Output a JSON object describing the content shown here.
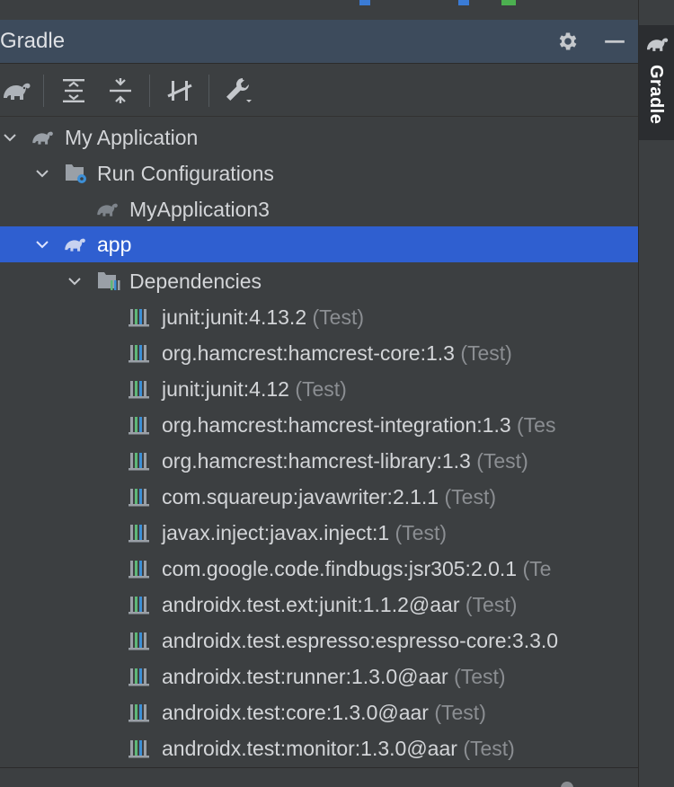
{
  "panel": {
    "title": "Gradle",
    "settings_icon": "gear-icon",
    "hide_icon": "minus-icon"
  },
  "toolbar": [
    {
      "name": "reload-gradle-button",
      "icon": "elephant-icon"
    },
    {
      "name": "expand-all-button",
      "icon": "expand-all-icon"
    },
    {
      "name": "collapse-all-button",
      "icon": "collapse-all-icon"
    },
    {
      "name": "toggle-offline-button",
      "icon": "offline-toggle-icon"
    },
    {
      "name": "build-settings-button",
      "icon": "wrench-icon"
    }
  ],
  "tree": {
    "root": {
      "label": "My Application",
      "expanded": true
    },
    "run_configurations": {
      "label": "Run Configurations",
      "expanded": true
    },
    "run_config_item": {
      "label": "MyApplication3"
    },
    "app": {
      "label": "app",
      "expanded": true,
      "selected": true
    },
    "dependencies": {
      "label": "Dependencies",
      "expanded": true
    },
    "deps": [
      {
        "name": "junit:junit:4.13.2",
        "scope": "(Test)"
      },
      {
        "name": "org.hamcrest:hamcrest-core:1.3",
        "scope": "(Test)"
      },
      {
        "name": "junit:junit:4.12",
        "scope": "(Test)"
      },
      {
        "name": "org.hamcrest:hamcrest-integration:1.3",
        "scope": "(Tes"
      },
      {
        "name": "org.hamcrest:hamcrest-library:1.3",
        "scope": "(Test)"
      },
      {
        "name": "com.squareup:javawriter:2.1.1",
        "scope": "(Test)"
      },
      {
        "name": "javax.inject:javax.inject:1",
        "scope": "(Test)"
      },
      {
        "name": "com.google.code.findbugs:jsr305:2.0.1",
        "scope": "(Te"
      },
      {
        "name": "androidx.test.ext:junit:1.1.2@aar",
        "scope": "(Test)"
      },
      {
        "name": "androidx.test.espresso:espresso-core:3.3.0",
        "scope": ""
      },
      {
        "name": "androidx.test:runner:1.3.0@aar",
        "scope": "(Test)"
      },
      {
        "name": "androidx.test:core:1.3.0@aar",
        "scope": "(Test)"
      },
      {
        "name": "androidx.test:monitor:1.3.0@aar",
        "scope": "(Test)"
      }
    ]
  },
  "sidebar": {
    "tab_label": "Gradle"
  },
  "colors": {
    "panel_bg": "#3c3f41",
    "header_bg": "#3d4b5c",
    "selection": "#2f5fd0",
    "text": "#d3d5d8",
    "muted": "#8b8e92"
  }
}
